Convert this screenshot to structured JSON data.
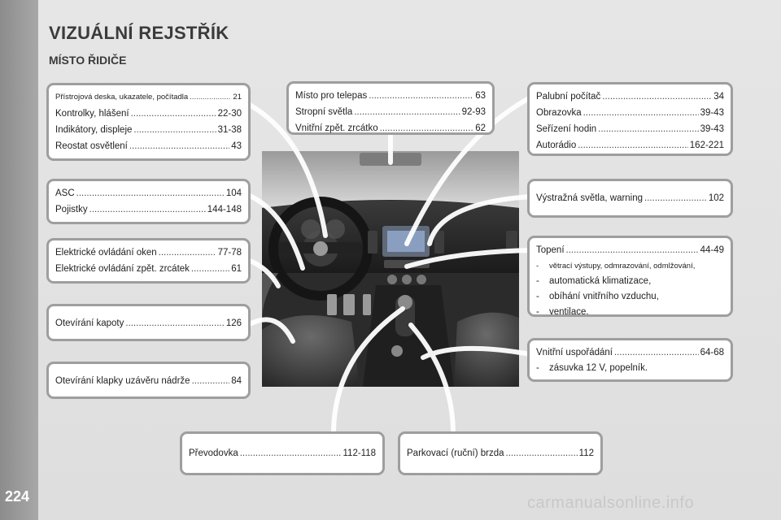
{
  "page": {
    "title": "VIZUÁLNÍ REJSTŘÍK",
    "subtitle": "MÍSTO ŘIDIČE",
    "page_number": "224",
    "watermark": "carmanualsonline.info"
  },
  "boxes": {
    "dashboard": [
      {
        "label": "Přístrojová deska, ukazatele, počítadla",
        "page": "21"
      },
      {
        "label": "Kontrolky, hlášení",
        "page": "22-30"
      },
      {
        "label": "Indikátory, displeje",
        "page": "31-38"
      },
      {
        "label": "Reostat osvětlení",
        "page": "43"
      }
    ],
    "asc": [
      {
        "label": "ASC",
        "page": "104"
      },
      {
        "label": "Pojistky",
        "page": "144-148"
      }
    ],
    "windows": [
      {
        "label": "Elektrické ovládání oken",
        "page": "77-78"
      },
      {
        "label": "Elektrické ovládání zpět. zrcátek",
        "page": "61"
      }
    ],
    "bonnet": [
      {
        "label": "Otevírání kapoty",
        "page": "126"
      }
    ],
    "fuel": [
      {
        "label": "Otevírání klapky uzávěru nádrže",
        "page": "84"
      }
    ],
    "ceiling": [
      {
        "label": "Místo pro telepas",
        "page": "63"
      },
      {
        "label": "Stropní světla",
        "page": "92-93"
      },
      {
        "label": "Vnitřní zpět. zrcátko",
        "page": "62"
      }
    ],
    "computer": [
      {
        "label": "Palubní počítač",
        "page": "34"
      },
      {
        "label": "Obrazovka",
        "page": "39-43"
      },
      {
        "label": "Seřízení hodin",
        "page": "39-43"
      },
      {
        "label": "Autorádio",
        "page": "162-221"
      }
    ],
    "hazard": [
      {
        "label": "Výstražná světla, warning",
        "page": "102"
      }
    ],
    "heating": {
      "label": "Topení",
      "page": "44-49",
      "items": [
        "větrací výstupy, odmrazování, odmlžování,",
        "automatická klimatizace,",
        "obíhání vnitřního vzduchu,",
        "ventilace."
      ]
    },
    "storage": {
      "label": "Vnitřní uspořádání",
      "page": "64-68",
      "items": [
        "zásuvka 12 V, popelník."
      ]
    },
    "gearbox": [
      {
        "label": "Převodovka",
        "page": "112-118"
      }
    ],
    "parking": [
      {
        "label": "Parkovací (ruční) brzda",
        "page": "112"
      }
    ],
    "dash_char": "-"
  },
  "colors": {
    "background": "#e3e3e3",
    "box_border": "#9e9e9e",
    "title": "#3b3b3b"
  }
}
